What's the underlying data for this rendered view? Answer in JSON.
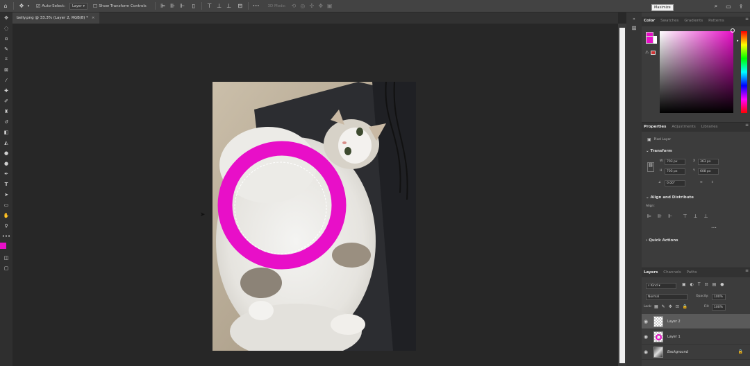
{
  "options_bar": {
    "auto_select_label": "Auto-Select:",
    "auto_select_value": "Layer",
    "transform_label": "Show Transform Controls",
    "mode_3d": "3D Mode:",
    "more": "•••"
  },
  "tooltip": "Maximize",
  "document_tab": {
    "title": "belly.png @ 33.3% (Layer 2, RGB/8) *",
    "close": "×"
  },
  "color_panel": {
    "tabs": [
      "Color",
      "Swatches",
      "Gradients",
      "Patterns"
    ],
    "foreground": "#e80fc8",
    "background": "#ffffff"
  },
  "properties_panel": {
    "tabs": [
      "Properties",
      "Adjustments",
      "Libraries"
    ],
    "layer_type": "Pixel Layer",
    "transform_title": "Transform",
    "w_label": "W",
    "w_value": "703 px",
    "x_label": "X",
    "x_value": "363 px",
    "h_label": "H",
    "h_value": "703 px",
    "y_label": "Y",
    "y_value": "608 px",
    "angle_value": "0.00°",
    "align_title": "Align and Distribute",
    "align_label": "Align:",
    "align_more": "•••",
    "quick_actions": "Quick Actions"
  },
  "layers_panel": {
    "tabs": [
      "Layers",
      "Channels",
      "Paths"
    ],
    "kind_value": "Kind",
    "blend_mode": "Normal",
    "opacity_label": "Opacity:",
    "opacity_value": "100%",
    "lock_label": "Lock:",
    "fill_label": "Fill:",
    "fill_value": "100%",
    "layers": [
      {
        "name": "Layer 2",
        "selected": true
      },
      {
        "name": "Layer 1",
        "selected": false
      },
      {
        "name": "Background",
        "selected": false
      }
    ]
  },
  "accent": "#e80fc8"
}
